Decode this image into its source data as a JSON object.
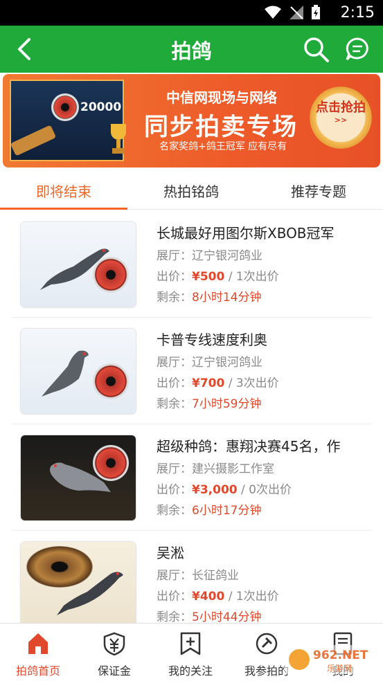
{
  "status": {
    "time": "2:15"
  },
  "appbar": {
    "title": "拍鸽"
  },
  "banner": {
    "screen_number": "20000",
    "line1": "中信网现场与网络",
    "line2": "同步拍卖专场",
    "line3": "名家奖鸽+鸽王冠军  应有尽有",
    "cta_main": "点击抢拍",
    "cta_sub": ">>"
  },
  "tabs": [
    {
      "label": "即将结束",
      "active": true
    },
    {
      "label": "热拍铭鸽",
      "active": false
    },
    {
      "label": "推荐专题",
      "active": false
    }
  ],
  "items": [
    {
      "name": "长城最好用图尔斯XBOB冠军",
      "hall_label": "展厅：",
      "hall": "辽宁银河鸽业",
      "bid_label": "出价：",
      "price": "¥500",
      "bids": " / 1次出价",
      "remain_label": "剩余：",
      "remain": "8小时14分钟"
    },
    {
      "name": "卡普专线速度利奥",
      "hall_label": "展厅：",
      "hall": "辽宁银河鸽业",
      "bid_label": "出价：",
      "price": "¥700",
      "bids": " / 3次出价",
      "remain_label": "剩余：",
      "remain": "7小时59分钟"
    },
    {
      "name": "超级种鸽：惠翔决赛45名，作",
      "hall_label": "展厅：",
      "hall": "建兴摄影工作室",
      "bid_label": "出价：",
      "price": "¥3,000",
      "bids": " / 0次出价",
      "remain_label": "剩余：",
      "remain": "6小时17分钟"
    },
    {
      "name": "吴淞",
      "hall_label": "展厅：",
      "hall": "长征鸽业",
      "bid_label": "出价：",
      "price": "¥400",
      "bids": " / 1次出价",
      "remain_label": "剩余：",
      "remain": "5小时44分钟"
    }
  ],
  "bottomnav": [
    {
      "label": "拍鸽首页",
      "icon": "home-icon",
      "active": true
    },
    {
      "label": "保证金",
      "icon": "deposit-icon",
      "active": false
    },
    {
      "label": "我的关注",
      "icon": "bookmark-add-icon",
      "active": false
    },
    {
      "label": "我参拍的",
      "icon": "auction-icon",
      "active": false
    },
    {
      "label": "我的",
      "icon": "document-icon",
      "active": false
    }
  ],
  "watermark": "962.NET 乐游网",
  "colors": {
    "primary_green": "#1faa3a",
    "accent_orange": "#f26522",
    "price_red": "#e0482b"
  }
}
